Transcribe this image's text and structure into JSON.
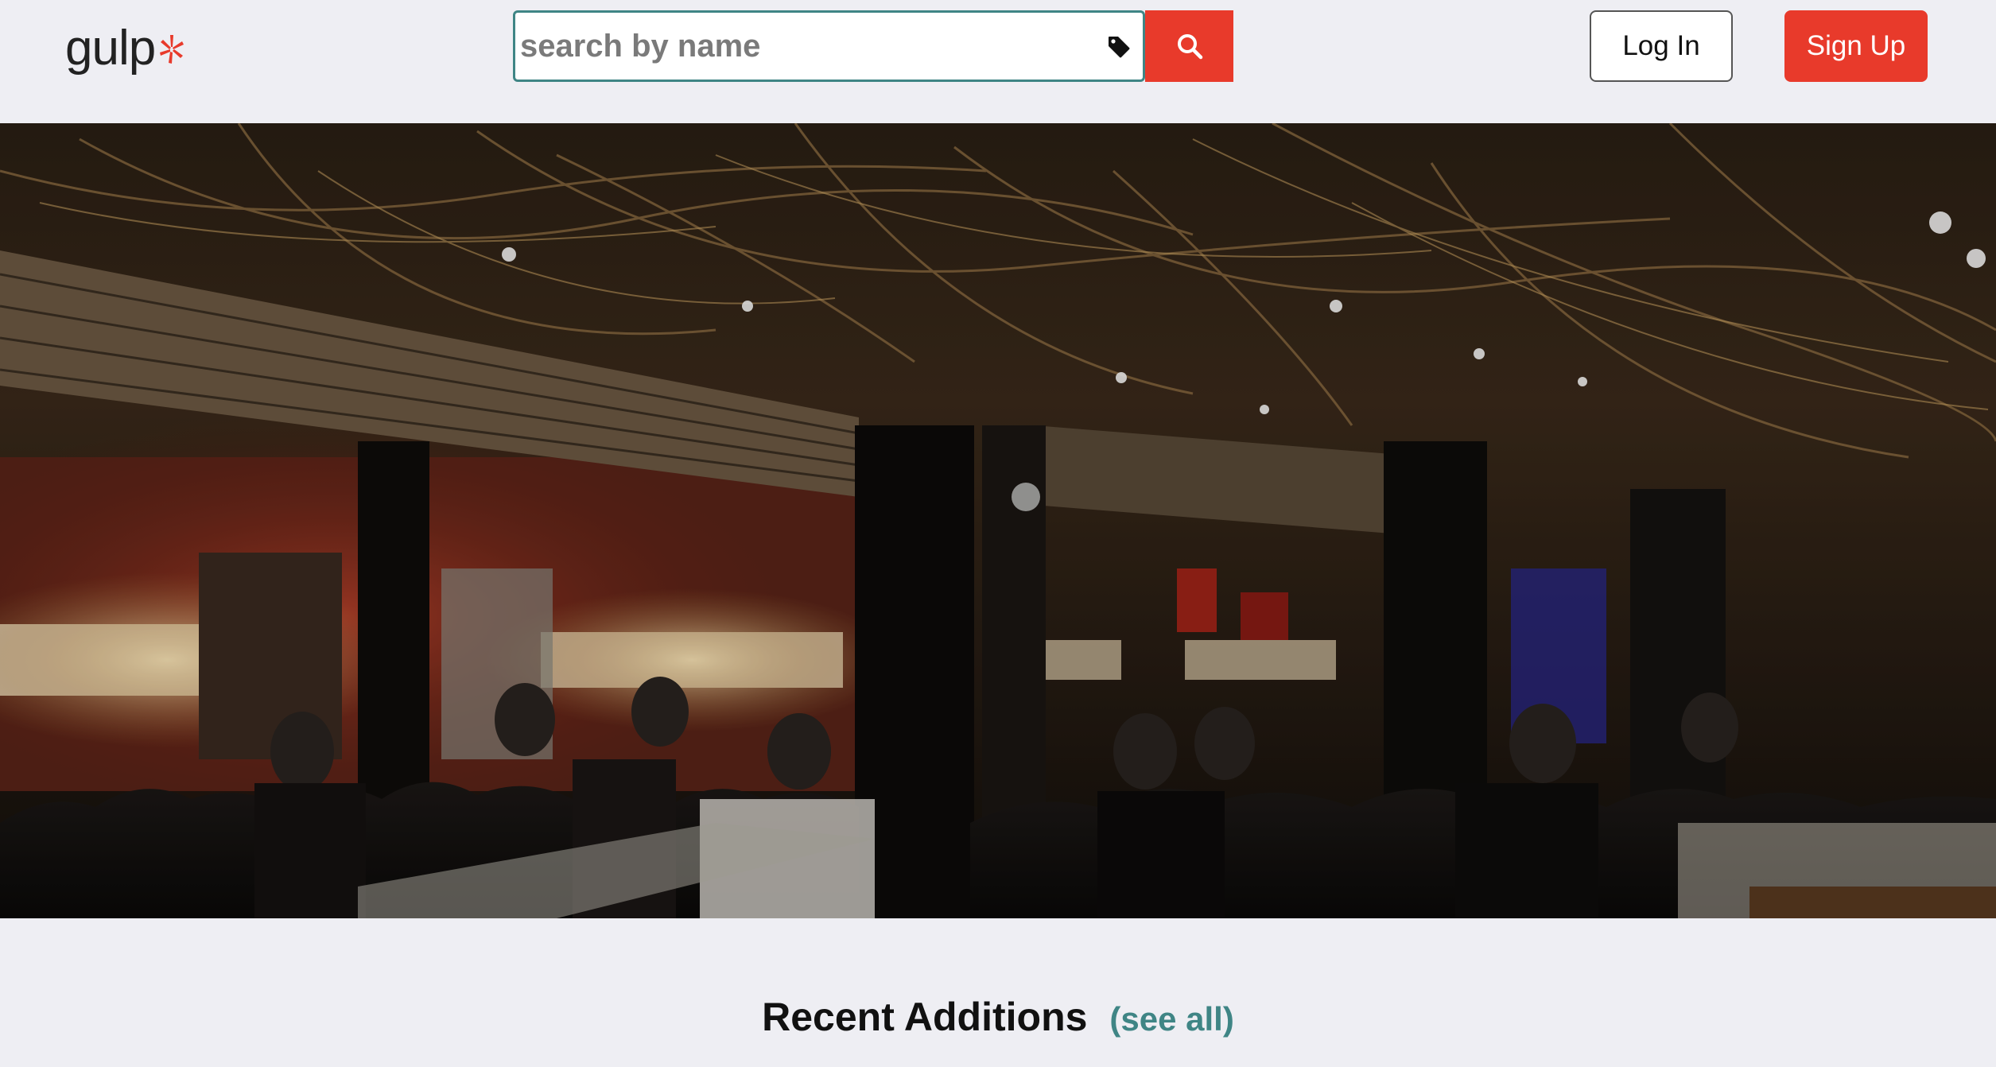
{
  "header": {
    "logo_text": "gulp",
    "search_placeholder": "search by name",
    "login_label": "Log In",
    "signup_label": "Sign Up"
  },
  "hero": {
    "description_icon": "restaurant-interior-photo"
  },
  "recent": {
    "title": "Recent Additions",
    "see_all_label": "(see all)"
  },
  "colors": {
    "accent_red": "#e83a2b",
    "teal": "#3f8585",
    "page_bg": "#eeeef3"
  },
  "icons": [
    "yelp-burst-icon",
    "tag-icon",
    "search-icon"
  ]
}
